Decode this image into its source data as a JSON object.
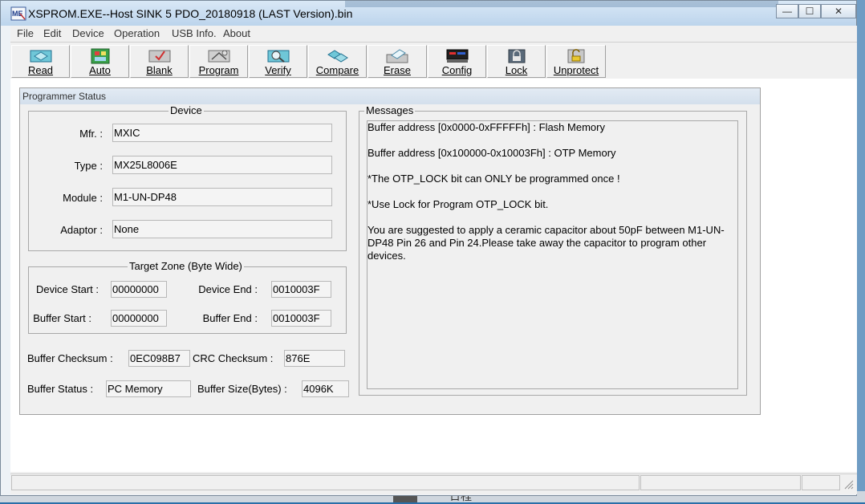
{
  "window": {
    "title": "XSPROM.EXE--Host SINK 5  PDO_20180918 (LAST Version).bin",
    "min_label": "—",
    "max_label": "☐",
    "close_label": "✕"
  },
  "menu": [
    "File",
    "Edit",
    "Device",
    "Operation",
    "USB Info.",
    "About"
  ],
  "toolbar": [
    {
      "label": "Read",
      "icon": "read-chip-icon"
    },
    {
      "label": "Auto",
      "icon": "auto-icon"
    },
    {
      "label": "Blank",
      "icon": "blank-check-icon"
    },
    {
      "label": "Program",
      "icon": "program-icon"
    },
    {
      "label": "Verify",
      "icon": "verify-icon"
    },
    {
      "label": "Compare",
      "icon": "compare-icon"
    },
    {
      "label": "Erase",
      "icon": "erase-icon"
    },
    {
      "label": "Config",
      "icon": "config-icon"
    },
    {
      "label": "Lock",
      "icon": "lock-icon"
    },
    {
      "label": "Unprotect",
      "icon": "unprotect-icon"
    }
  ],
  "panel": {
    "title": "Programmer Status",
    "device": {
      "legend": "Device",
      "mfr_label": "Mfr. :",
      "mfr": "MXIC",
      "type_label": "Type :",
      "type": "MX25L8006E",
      "module_label": "Module :",
      "module": "M1-UN-DP48",
      "adaptor_label": "Adaptor :",
      "adaptor": "None"
    },
    "target": {
      "legend": "Target Zone (Byte Wide)",
      "device_start_label": "Device Start :",
      "device_start": "00000000",
      "device_end_label": "Device End :",
      "device_end": "0010003F",
      "buffer_start_label": "Buffer Start :",
      "buffer_start": "00000000",
      "buffer_end_label": "Buffer End :",
      "buffer_end": "0010003F"
    },
    "checksum": {
      "buffer_label": "Buffer Checksum :",
      "buffer": "0EC098B7",
      "crc_label": "CRC Checksum :",
      "crc": "876E"
    },
    "status": {
      "buffer_status_label": "Buffer Status :",
      "buffer_status": "PC Memory",
      "buffer_size_label": "Buffer Size(Bytes) :",
      "buffer_size": "4096K"
    },
    "messages": {
      "legend": "Messages",
      "lines": [
        "Buffer address [0x0000-0xFFFFFh] : Flash Memory",
        "Buffer address [0x100000-0x10003Fh] : OTP Memory",
        "*The OTP_LOCK bit can ONLY be programmed once !",
        "*Use Lock for Program OTP_LOCK bit.",
        "You are suggested to apply a ceramic capacitor about 50pF between M1-UN-DP48 Pin 26 and Pin 24.Please take away the capacitor to program other devices."
      ]
    }
  },
  "background_text": "日程"
}
